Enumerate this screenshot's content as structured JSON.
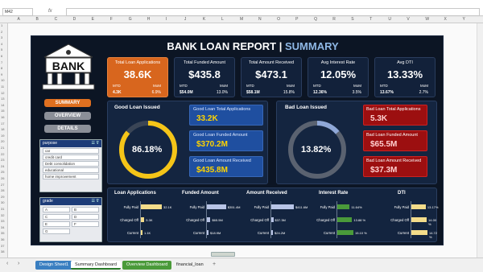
{
  "formula_bar": {
    "namebox": "M42",
    "fx": "fx"
  },
  "columns": [
    "A",
    "B",
    "C",
    "D",
    "E",
    "F",
    "G",
    "H",
    "I",
    "J",
    "K",
    "L",
    "M",
    "N",
    "O",
    "P",
    "Q",
    "R",
    "S",
    "T",
    "U",
    "V",
    "W",
    "X",
    "Y"
  ],
  "dashboard": {
    "title_main": "BANK LOAN REPORT |",
    "title_sub": "SUMMARY",
    "bank_text": "BANK",
    "nav": [
      "SUMMARY",
      "OVERVIEW",
      "DETAILS"
    ],
    "kpis": [
      {
        "title": "Total Loan Applications",
        "value": "38.6K",
        "l1": "MTD",
        "l2": "MoM",
        "v1": "4.3K",
        "v2": "6.9%"
      },
      {
        "title": "Total Funded Amount",
        "value": "$435.8",
        "l1": "MTD",
        "l2": "MoM",
        "v1": "$54.0M",
        "v2": "13.0%"
      },
      {
        "title": "Total Amount Received",
        "value": "$473.1",
        "l1": "MTD",
        "l2": "MoM",
        "v1": "$58.1M",
        "v2": "15.8%"
      },
      {
        "title": "Avg Interest Rate",
        "value": "12.05%",
        "l1": "MTD",
        "l2": "MoM",
        "v1": "12.36%",
        "v2": "3.5%"
      },
      {
        "title": "Avg DTI",
        "value": "13.33%",
        "l1": "MTD",
        "l2": "MoM",
        "v1": "13.67%",
        "v2": "2.7%"
      }
    ],
    "good": {
      "title": "Good Loan Issued",
      "pct": "86.18%",
      "pct_num": 86.18,
      "cards": [
        {
          "t": "Good Loan Total Applications",
          "v": "33.2K"
        },
        {
          "t": "Good Loan Funded Amount",
          "v": "$370.2M"
        },
        {
          "t": "Good Loan Amount Received",
          "v": "$435.8M"
        }
      ]
    },
    "bad": {
      "title": "Bad Loan Issued",
      "pct": "13.82%",
      "pct_num": 13.82,
      "cards": [
        {
          "t": "Bad Loan Total Applications",
          "v": "5.3K"
        },
        {
          "t": "Bad Loan Funded Amount",
          "v": "$65.5M"
        },
        {
          "t": "Bad Loan Amount Received",
          "v": "$37.3M"
        }
      ]
    },
    "purpose": {
      "header": "purpose",
      "items": [
        "car",
        "credit card",
        "Debt consolidation",
        "educational",
        "home improvement"
      ]
    },
    "grade": {
      "header": "grade",
      "items": [
        "A",
        "B",
        "C",
        "D",
        "E",
        "F",
        "G"
      ]
    },
    "bottom": {
      "headers": [
        "Loan Applications",
        "Funded Amount",
        "Amount Received",
        "Interest Rate",
        "DTI"
      ],
      "rows": [
        "Fully Paid",
        "Charged Off",
        "Current"
      ],
      "loan_apps": {
        "labels": [
          "32.1K",
          "5.3K",
          "1.1K"
        ],
        "values": [
          32.1,
          5.3,
          1.1
        ]
      },
      "funded": {
        "labels": [
          "$351.4M",
          "$65.5M",
          "$18.9M"
        ],
        "values": [
          351.4,
          65.5,
          18.9
        ]
      },
      "received": {
        "labels": [
          "$411.6M",
          "$37.3M",
          "$24.2M"
        ],
        "values": [
          411.6,
          37.3,
          24.2
        ]
      },
      "interest": {
        "labels": [
          "11.64%",
          "13.88 %",
          "15.10 %"
        ],
        "values": [
          11.64,
          13.88,
          15.1
        ]
      },
      "dti": {
        "labels": [
          "13.17%",
          "14.00 %",
          "14.72 %"
        ],
        "values": [
          13.17,
          14.0,
          14.72
        ]
      }
    }
  },
  "tabs": [
    "Design Sheet1",
    "Summary Dashboard",
    "Overview Dashboard",
    "financial_loan"
  ],
  "colors": {
    "orange": "#d8661e",
    "gold": "#f5c518",
    "red": "#9c0f10",
    "blue": "#1f4fa0",
    "green": "#4a9a3a",
    "yellowbar": "#f3dc8a"
  }
}
